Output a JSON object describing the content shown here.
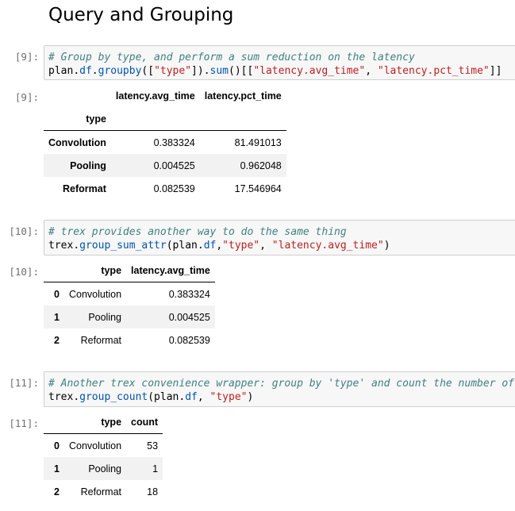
{
  "notebook": {
    "title": "Query and Grouping"
  },
  "cells": [
    {
      "in_prompt": "[9]:",
      "out_prompt": "[9]:",
      "code": {
        "comment": "# Group by type, and perform a sum reduction on the latency",
        "line2": {
          "a": "plan",
          "b": ".",
          "c": "df",
          "d": ".",
          "e": "groupby",
          "f": "([",
          "g": "\"type\"",
          "h": "]).",
          "i": "sum",
          "j": "()[[",
          "k": "\"latency.avg_time\"",
          "l": ", ",
          "m": "\"latency.pct_time\"",
          "n": "]]"
        }
      },
      "table": {
        "columns": [
          "latency.avg_time",
          "latency.pct_time"
        ],
        "index_name": "type",
        "rows": [
          {
            "index": "Convolution",
            "v1": "0.383324",
            "v2": "81.491013"
          },
          {
            "index": "Pooling",
            "v1": "0.004525",
            "v2": "0.962048"
          },
          {
            "index": "Reformat",
            "v1": "0.082539",
            "v2": "17.546964"
          }
        ]
      }
    },
    {
      "in_prompt": "[10]:",
      "out_prompt": "[10]:",
      "code": {
        "comment": "# trex provides another way to do the same thing",
        "line2": {
          "a": "trex",
          "b": ".",
          "c": "group_sum_attr",
          "d": "(plan.",
          "e": "df",
          "f": ",",
          "g": "\"type\"",
          "h": ", ",
          "i": "\"latency.avg_time\"",
          "j": ")"
        }
      },
      "table": {
        "columns": [
          "type",
          "latency.avg_time"
        ],
        "rows": [
          {
            "index": "0",
            "v1": "Convolution",
            "v2": "0.383324"
          },
          {
            "index": "1",
            "v1": "Pooling",
            "v2": "0.004525"
          },
          {
            "index": "2",
            "v1": "Reformat",
            "v2": "0.082539"
          }
        ]
      }
    },
    {
      "in_prompt": "[11]:",
      "out_prompt": "[11]:",
      "code": {
        "comment": "# Another trex convenience wrapper: group by 'type' and count the number of",
        "line2": {
          "a": "trex",
          "b": ".",
          "c": "group_count",
          "d": "(plan.",
          "e": "df",
          "f": ", ",
          "g": "\"type\"",
          "h": ")"
        }
      },
      "table": {
        "columns": [
          "type",
          "count"
        ],
        "rows": [
          {
            "index": "0",
            "v1": "Convolution",
            "v2": "53"
          },
          {
            "index": "1",
            "v1": "Pooling",
            "v2": "1"
          },
          {
            "index": "2",
            "v1": "Reformat",
            "v2": "18"
          }
        ]
      }
    }
  ]
}
